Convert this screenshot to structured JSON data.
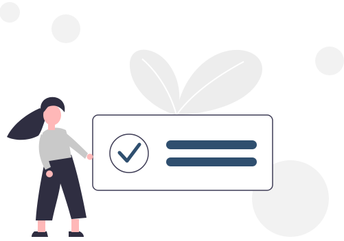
{
  "illustration": {
    "subject": "person-presenting-checklist-card",
    "card": {
      "icon": "check-circle-icon",
      "text_lines": 2
    }
  },
  "colors": {
    "background": "#ffffff",
    "bubble": "#f2f2f2",
    "leaf": "#ededed",
    "leaf_vein": "#ffffff",
    "card_fill": "#ffffff",
    "card_stroke": "#3f3d56",
    "accent": "#2f4f6f",
    "hair": "#2f2e41",
    "skin": "#ffb8b8",
    "shirt": "#c9c9c9",
    "pants": "#2f2e41",
    "shoes": "#2f2e41"
  }
}
